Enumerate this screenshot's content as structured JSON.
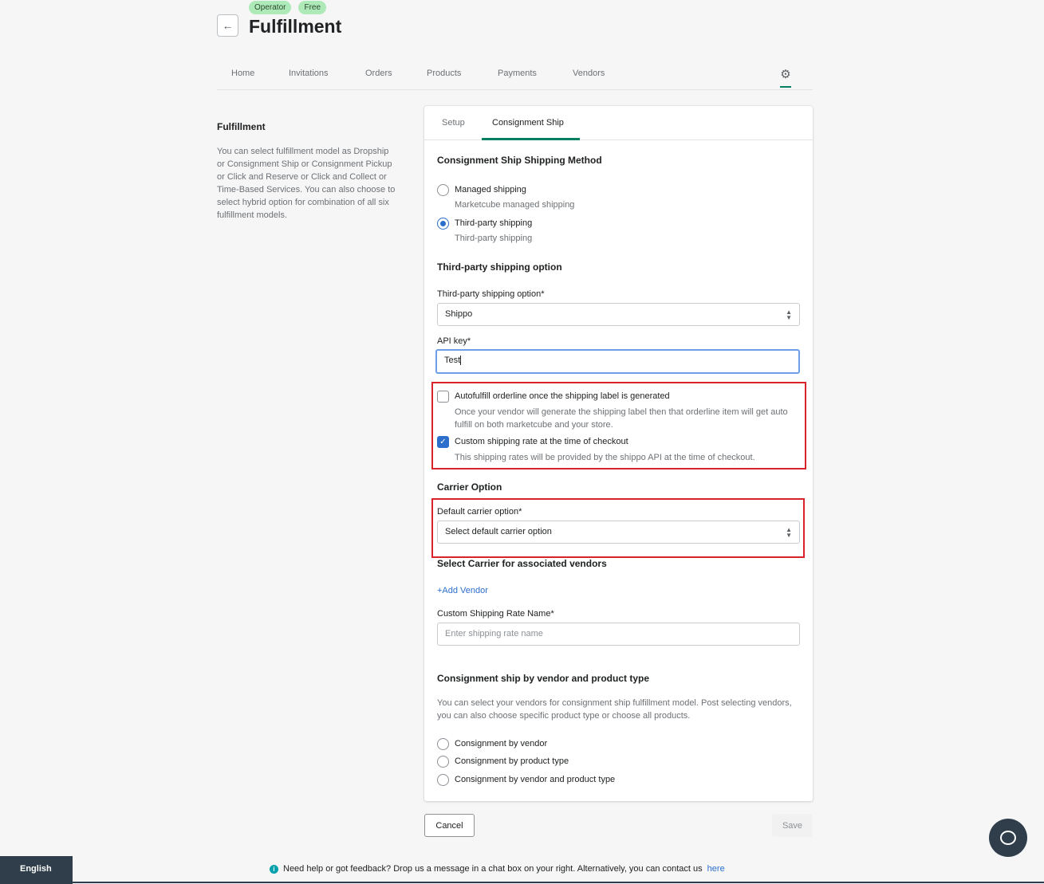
{
  "header": {
    "badges": [
      "Operator",
      "Free"
    ],
    "title": "Fulfillment",
    "back_icon": "arrow-left-icon"
  },
  "nav": {
    "items": [
      "Home",
      "Invitations",
      "Orders",
      "Products",
      "Payments",
      "Vendors"
    ],
    "settings_icon": "gear-icon"
  },
  "sidebar": {
    "title": "Fulfillment",
    "description": "You can select fulfillment model as Dropship or Consignment Ship or Consignment Pickup or Click and Reserve or Click and Collect or Time-Based Services. You can also choose to select hybrid option for combination of all six fulfillment models."
  },
  "card": {
    "tabs": [
      "Setup",
      "Consignment Ship"
    ],
    "active_tab": "Consignment Ship",
    "shipping_method": {
      "title": "Consignment Ship Shipping Method",
      "options": [
        {
          "label": "Managed shipping",
          "help": "Marketcube managed shipping",
          "checked": false
        },
        {
          "label": "Third-party shipping",
          "help": "Third-party shipping",
          "checked": true
        }
      ]
    },
    "third_party": {
      "title": "Third-party shipping option",
      "option_label": "Third-party shipping option*",
      "option_value": "Shippo",
      "api_label": "API key*",
      "api_value": "Test"
    },
    "checks": [
      {
        "label": "Autofulfill orderline once the shipping label is generated",
        "help": "Once your vendor will generate the shipping label then that orderline item will get auto fulfill on both marketcube and your store.",
        "checked": false
      },
      {
        "label": "Custom shipping rate at the time of checkout",
        "help": "This shipping rates will be provided by the shippo API at the time of checkout.",
        "checked": true
      }
    ],
    "carrier": {
      "title": "Carrier Option",
      "default_label": "Default carrier option*",
      "default_value": "Select default carrier option",
      "vendors_title": "Select Carrier for associated vendors",
      "add_vendor": "+Add Vendor",
      "rate_label": "Custom Shipping Rate Name*",
      "rate_placeholder": "Enter shipping rate name"
    },
    "consignment": {
      "title": "Consignment ship by vendor and product type",
      "description": "You can select your vendors for consignment ship fulfillment model. Post selecting vendors, you can also choose specific product type or choose all products.",
      "options": [
        "Consignment by vendor",
        "Consignment by product type",
        "Consignment by vendor and product type"
      ]
    }
  },
  "actions": {
    "cancel": "Cancel",
    "save": "Save"
  },
  "footer": {
    "language": "English",
    "help_text": "Need help or got feedback? Drop us a message in a chat box on your right. Alternatively, you can contact us",
    "link": "here"
  },
  "colors": {
    "accent": "#008060",
    "primary": "#2c6ecb",
    "highlight": "#d8232a",
    "badge": "#aee9b8"
  }
}
